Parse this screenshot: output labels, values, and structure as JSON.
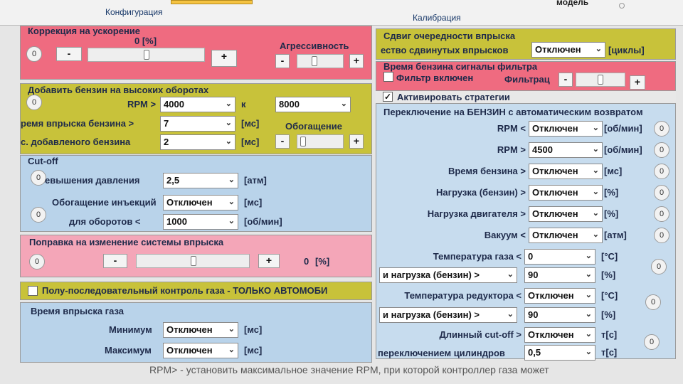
{
  "tabs": {
    "config": "Конфигурация",
    "calibration": "Калибрация",
    "model": "модель"
  },
  "accel": {
    "title": "Коррекция на ускорение",
    "value": "0 [%]",
    "aggr_label": "Агрессивность",
    "circle": "0",
    "minus": "-",
    "plus": "+"
  },
  "highrpm": {
    "title": "Добавить бензин на высоких оборотах",
    "rpm_label": "RPM >",
    "rpm_from": "4000",
    "to_label": "к",
    "rpm_to": "8000",
    "inj_label": "ремя впрыска бензина >",
    "inj_value": "7",
    "inj_unit": "[мс]",
    "enrich_label": "Обогащение",
    "added_label": "с. добавленого бензина",
    "added_value": "2",
    "added_unit": "[мс]",
    "circle": "0",
    "minus": "-",
    "plus": "+"
  },
  "cutoff": {
    "title": "Cut-off",
    "press_label": "евышения давления",
    "press_value": "2,5",
    "press_unit": "[атм]",
    "inj_label": "Обогащение инъекций",
    "inj_value": "Отключен",
    "inj_unit": "[мс]",
    "rpm_label": "для оборотов <",
    "rpm_value": "1000",
    "rpm_unit": "[об/мин]",
    "circle1": "0",
    "circle2": "0"
  },
  "correction": {
    "title": "Поправка на изменение системы впрыска",
    "value": "0",
    "unit": "[%]",
    "circle": "0",
    "minus": "-",
    "plus": "+"
  },
  "semiseq": {
    "label": "Полу-последовательный контроль газа - ТОЛЬКО АВТОМОБИ"
  },
  "gasinj": {
    "title": "Время впрыска газа",
    "min_label": "Минимум",
    "min_value": "Отключен",
    "min_unit": "[мс]",
    "max_label": "Максимум",
    "max_value": "Отключен",
    "max_unit": "[мс]"
  },
  "shift": {
    "title": "Сдвиг очередности впрыска",
    "count_label": "ество сдвинутых впрысков",
    "count_value": "Отключен",
    "unit": "[циклы]"
  },
  "filter": {
    "title": "Время бензина сигналы фильтра",
    "enabled_label": "Фильтр включен",
    "filter_label": "Фильтрац",
    "minus": "-",
    "plus": "+"
  },
  "strategy": {
    "activate_label": "Активировать стратегии"
  },
  "switchback": {
    "title": "Переключение на БЕНЗИН с автоматическим возвратом",
    "rows": [
      {
        "label": "RPM <",
        "value": "Отключен",
        "unit": "[об/мин]",
        "circle": "0"
      },
      {
        "label": "RPM >",
        "value": "4500",
        "unit": "[об/мин]",
        "circle": "0"
      },
      {
        "label": "Время бензина >",
        "value": "Отключен",
        "unit": "[мс]",
        "circle": "0"
      },
      {
        "label": "Нагрузка (бензин) >",
        "value": "Отключен",
        "unit": "[%]",
        "circle": "0"
      },
      {
        "label": "Нагрузка двигателя >",
        "value": "Отключен",
        "unit": "[%]",
        "circle": "0"
      },
      {
        "label": "Вакуум <",
        "value": "Отключен",
        "unit": "[атм]",
        "circle": "0"
      }
    ],
    "gas_temp_label": "Температура газа <",
    "gas_temp_value": "0",
    "gas_temp_unit": "[°C]",
    "load1_label": "и нагрузка (бензин) >",
    "load1_value": "90",
    "load1_unit": "[%]",
    "red_temp_label": "Температура редуктора <",
    "red_temp_value": "Отключен",
    "red_temp_unit": "[°C]",
    "load2_label": "и нагрузка (бензин) >",
    "load2_value": "90",
    "load2_unit": "[%]",
    "long_cut_label": "Длинный cut-off >",
    "long_cut_value": "Отключен",
    "long_cut_unit": "т[с]",
    "cyl_label": "переключением цилиндров",
    "cyl_value": "0,5",
    "cyl_unit": "т[с]",
    "circle_a": "0",
    "circle_b": "0",
    "circle_c": "0"
  },
  "footer_text": "RPM> - установить максимальное значение RPM, при которой контроллер газа может"
}
